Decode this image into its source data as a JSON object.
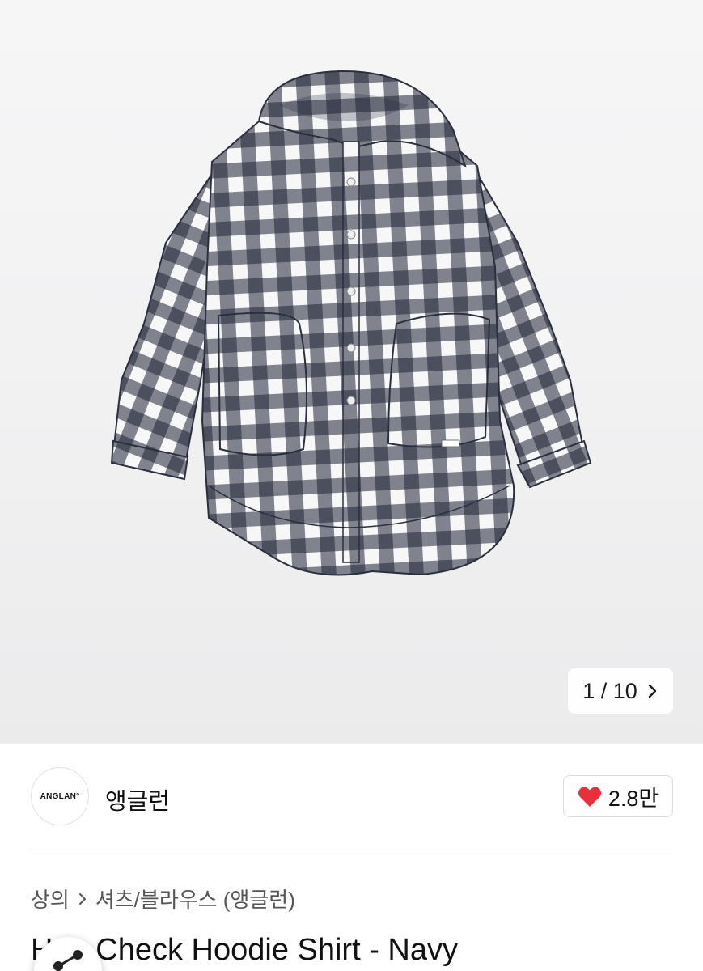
{
  "gallery": {
    "counter_text": "1 / 10",
    "next_icon": "chevron-right-icon",
    "product_image": "navy-white-gingham-hoodie-shirt"
  },
  "brand": {
    "logo_text": "ANGLAN°",
    "name": "앵글런"
  },
  "likes": {
    "icon": "heart-icon",
    "color": "#e8303a",
    "count": "2.8만"
  },
  "breadcrumb": {
    "category": "상의",
    "subcategory": "셔츠/블라우스 (앵글런)",
    "separator_icon": "chevron-right-icon"
  },
  "product": {
    "title": "Hue Check Hoodie Shirt - Navy"
  },
  "share": {
    "icon": "share-icon"
  },
  "colors": {
    "navy": "#1e2436",
    "white": "#f7f7f7",
    "heart": "#e8303a"
  }
}
